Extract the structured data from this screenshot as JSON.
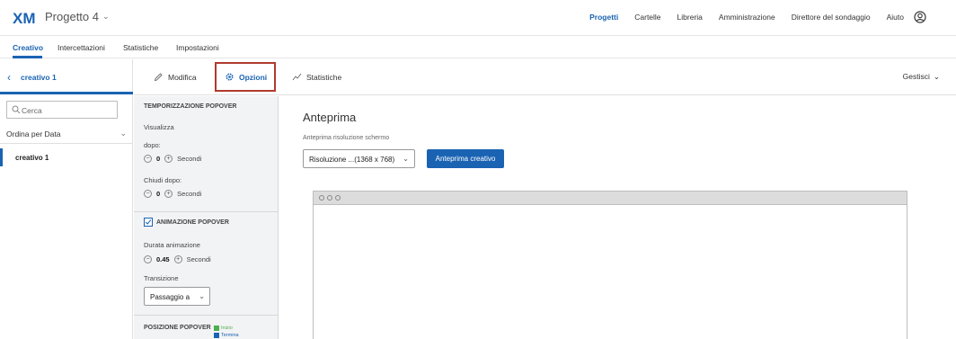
{
  "app": {
    "logo_text": "XM",
    "project_title": "Progetto 4"
  },
  "topnav": [
    "Progetti",
    "Cartelle",
    "Libreria",
    "Amministrazione",
    "Direttore del sondaggio",
    "Aiuto"
  ],
  "subtabs": [
    "Creativo",
    "Intercettazioni",
    "Statistiche",
    "Impostazioni"
  ],
  "left": {
    "title": "creativo 1",
    "search_placeholder": "Cerca",
    "sort_label": "Ordina per Data",
    "items": [
      "creativo 1"
    ]
  },
  "toolbar": {
    "modifica": "Modifica",
    "opzioni": "Opzioni",
    "statistiche": "Statistiche",
    "gestisci": "Gestisci"
  },
  "options": {
    "timing_header": "TEMPORIZZAZIONE POPOVER",
    "show_label": "Visualizza",
    "after_label": "dopo:",
    "after_value": "0",
    "seconds": "Secondi",
    "close_label": "Chiudi dopo:",
    "close_value": "0",
    "animation_header": "ANIMAZIONE POPOVER",
    "animation_checked": true,
    "duration_label": "Durata animazione",
    "duration_value": "0.45",
    "transition_label": "Transizione",
    "transition_value": "Passaggio a",
    "position_header": "POSIZIONE POPOVER",
    "legend_start": "Inizio",
    "legend_end": "Termina"
  },
  "preview": {
    "title": "Anteprima",
    "resolution_label": "Anteprima risoluzione schermo",
    "resolution_value": "Risoluzione ...(1368 x 768)",
    "button": "Anteprima creativo"
  },
  "colors": {
    "accent": "#1a63b3",
    "highlight_box": "#b03a2e",
    "legend_start": "#4caf50",
    "legend_end": "#1a63b3"
  }
}
